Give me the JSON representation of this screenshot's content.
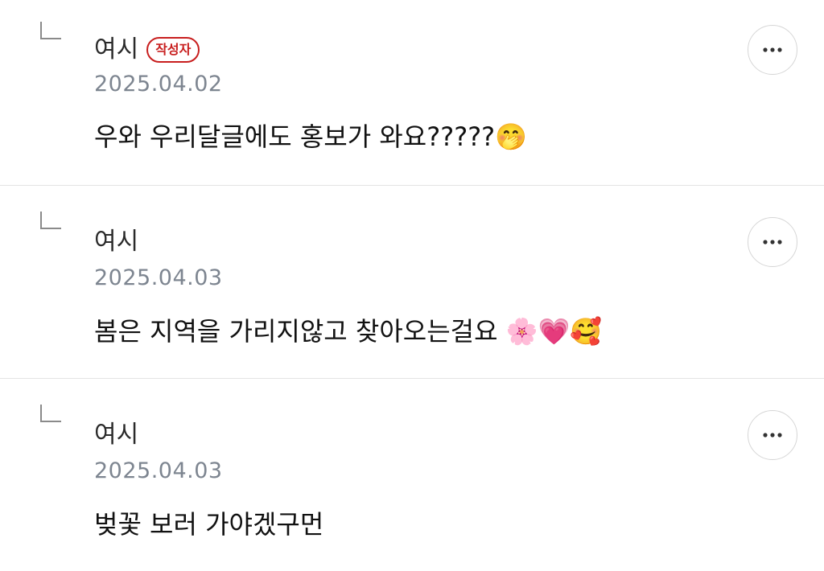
{
  "comments": [
    {
      "author": "여시",
      "badge": "작성자",
      "date": "2025.04.02",
      "text": "우와 우리달글에도 홍보가 와요?????🤭"
    },
    {
      "author": "여시",
      "date": "2025.04.03",
      "text": "봄은 지역을 가리지않고 찾아오는걸요 🌸💗🥰"
    },
    {
      "author": "여시",
      "date": "2025.04.03",
      "text": "벚꽃 보러 가야겠구먼"
    }
  ],
  "icons": {
    "reply": "reply-corner-icon",
    "more": "more-horizontal-icon"
  },
  "colors": {
    "badge": "#c81e1e",
    "date": "#7d8590",
    "divider": "#e3e3e3"
  }
}
